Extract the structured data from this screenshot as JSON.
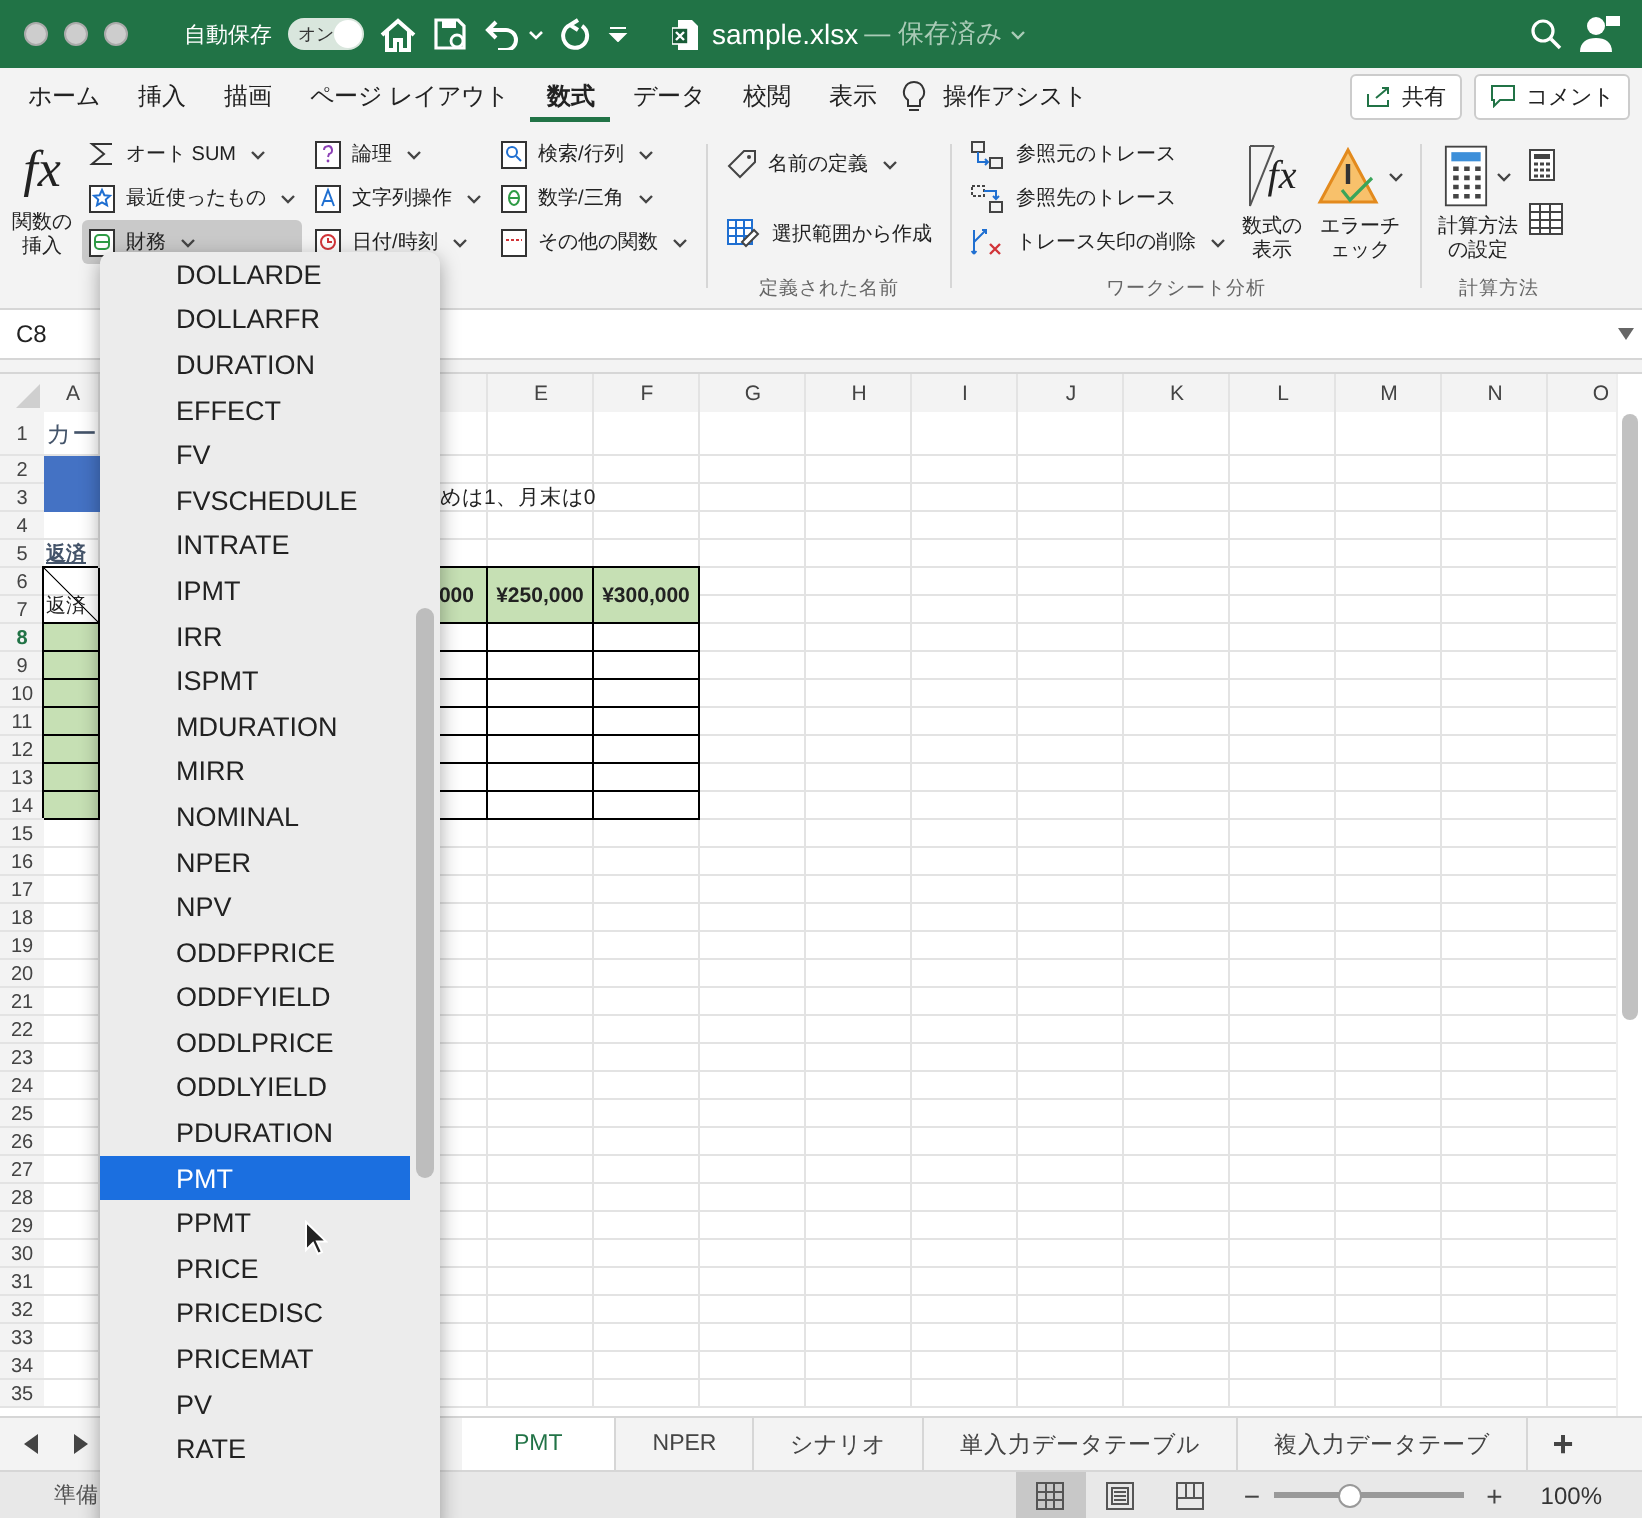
{
  "title_bar": {
    "autosave_label": "自動保存",
    "autosave_toggle": {
      "label": "オン",
      "on": true
    },
    "file_name": "sample.xlsx",
    "save_status": "— 保存済み"
  },
  "ribbon_tabs": [
    {
      "label": "ホーム",
      "selected": false
    },
    {
      "label": "挿入",
      "selected": false
    },
    {
      "label": "描画",
      "selected": false
    },
    {
      "label": "ページ レイアウト",
      "selected": false
    },
    {
      "label": "数式",
      "selected": true
    },
    {
      "label": "データ",
      "selected": false
    },
    {
      "label": "校閲",
      "selected": false
    },
    {
      "label": "表示",
      "selected": false
    }
  ],
  "assist": "操作アシスト",
  "share_button": "共有",
  "comment_button": "コメント",
  "ribbon": {
    "insert_function": {
      "icon": "fx",
      "label": "関数の挿入"
    },
    "function_columns": [
      [
        {
          "label": "オート SUM",
          "kind": "sum",
          "pressed": false
        },
        {
          "label": "最近使ったもの",
          "kind": "star",
          "pressed": false
        },
        {
          "label": "財務",
          "kind": "finance",
          "pressed": true
        }
      ],
      [
        {
          "label": "論理",
          "kind": "logic",
          "pressed": false
        },
        {
          "label": "文字列操作",
          "kind": "text",
          "pressed": false
        },
        {
          "label": "日付/時刻",
          "kind": "clock",
          "pressed": false
        }
      ],
      [
        {
          "label": "検索/行列",
          "kind": "lookup",
          "pressed": false
        },
        {
          "label": "数学/三角",
          "kind": "math",
          "pressed": false
        },
        {
          "label": "その他の関数",
          "kind": "more",
          "pressed": false
        }
      ]
    ],
    "names_group": {
      "label": "定義された名前",
      "items": [
        {
          "label": "名前の定義",
          "kind": "tag",
          "dropdown": true
        },
        {
          "label": "選択範囲から作成",
          "kind": "table",
          "dropdown": false
        }
      ]
    },
    "audit_group": {
      "label": "ワークシート分析",
      "items": [
        {
          "label": "参照元のトレース",
          "kind": "precedents",
          "dropdown": false
        },
        {
          "label": "参照先のトレース",
          "kind": "dependents",
          "dropdown": false
        },
        {
          "label": "トレース矢印の削除",
          "kind": "remove",
          "dropdown": true
        }
      ],
      "big": [
        {
          "label": "数式の表示",
          "kind": "formula",
          "icon": "fx",
          "dropdown": false
        },
        {
          "label": "エラーチェック",
          "kind": "warning",
          "dropdown": true
        }
      ]
    },
    "calc_group": {
      "label": "計算方法",
      "button": {
        "label": "計算方法の設定",
        "dropdown": true
      }
    }
  },
  "formula_bar": {
    "name_box": "C8"
  },
  "grid": {
    "columns": [
      {
        "label": "A"
      },
      {},
      {},
      {},
      {
        "label": "E"
      },
      {
        "label": "F"
      },
      {
        "label": "G"
      },
      {
        "label": "H"
      },
      {
        "label": "I"
      },
      {
        "label": "J"
      },
      {
        "label": "K"
      },
      {
        "label": "L"
      },
      {
        "label": "M"
      },
      {
        "label": "N"
      },
      {
        "label": "O"
      }
    ],
    "rows": [
      {
        "label": "1",
        "active": false,
        "cells": [
          {
            "text": "カー",
            "kind": "title"
          }
        ]
      },
      {
        "label": "2",
        "active": false,
        "cells": [
          {
            "color": "#4472c4"
          }
        ]
      },
      {
        "label": "3",
        "active": false,
        "cells": [
          {
            "color": "#4472c4"
          },
          {},
          {},
          {
            "text": "めは1、月末は0",
            "kind": "overflow"
          }
        ]
      },
      {
        "label": "4",
        "active": false
      },
      {
        "label": "5",
        "active": false,
        "cells": [
          {
            "text": "返済",
            "kind": "heading"
          }
        ]
      },
      {
        "label": "6",
        "active": false,
        "cells": [
          {
            "text": "返済",
            "kind": "diagonal",
            "merged": true
          },
          {},
          {},
          {
            "text": "000",
            "kind": "clipped",
            "merged": true,
            "color": "#c6e0b4"
          },
          {
            "text": "¥250,000",
            "kind": "money",
            "merged": true,
            "color": "#c6e0b4"
          },
          {
            "text": "¥300,000",
            "kind": "money",
            "merged": true,
            "color": "#c6e0b4"
          }
        ]
      },
      {
        "label": "7",
        "active": false
      },
      {
        "label": "8",
        "active": true,
        "cells": [
          {
            "kind": "box",
            "color": "#c6e0b4"
          },
          {},
          {},
          {
            "kind": "box"
          },
          {
            "kind": "box"
          },
          {
            "kind": "box"
          }
        ]
      },
      {
        "label": "9",
        "active": false,
        "cells": [
          {
            "kind": "box",
            "color": "#c6e0b4"
          },
          {},
          {},
          {
            "kind": "box"
          },
          {
            "kind": "box"
          },
          {
            "kind": "box"
          }
        ]
      },
      {
        "label": "10",
        "active": false,
        "cells": [
          {
            "kind": "box",
            "color": "#c6e0b4"
          },
          {},
          {},
          {
            "kind": "box"
          },
          {
            "kind": "box"
          },
          {
            "kind": "box"
          }
        ]
      },
      {
        "label": "11",
        "active": false,
        "cells": [
          {
            "kind": "box",
            "color": "#c6e0b4"
          },
          {},
          {},
          {
            "kind": "box"
          },
          {
            "kind": "box"
          },
          {
            "kind": "box"
          }
        ]
      },
      {
        "label": "12",
        "active": false,
        "cells": [
          {
            "kind": "box",
            "color": "#c6e0b4"
          },
          {},
          {},
          {
            "kind": "box"
          },
          {
            "kind": "box"
          },
          {
            "kind": "box"
          }
        ]
      },
      {
        "label": "13",
        "active": false,
        "cells": [
          {
            "kind": "box",
            "color": "#c6e0b4"
          },
          {},
          {},
          {
            "kind": "box"
          },
          {
            "kind": "box"
          },
          {
            "kind": "box"
          }
        ]
      },
      {
        "label": "14",
        "active": false,
        "cells": [
          {
            "kind": "box",
            "color": "#c6e0b4"
          },
          {},
          {},
          {
            "kind": "box"
          },
          {
            "kind": "box"
          },
          {
            "kind": "box"
          }
        ]
      },
      {
        "label": "15",
        "active": false
      },
      {
        "label": "16",
        "active": false
      },
      {
        "label": "17",
        "active": false
      },
      {
        "label": "18",
        "active": false
      },
      {
        "label": "19",
        "active": false
      },
      {
        "label": "20",
        "active": false
      },
      {
        "label": "21",
        "active": false
      },
      {
        "label": "22",
        "active": false
      },
      {
        "label": "23",
        "active": false
      },
      {
        "label": "24",
        "active": false
      },
      {
        "label": "25",
        "active": false
      },
      {
        "label": "26",
        "active": false
      },
      {
        "label": "27",
        "active": false
      },
      {
        "label": "28",
        "active": false
      },
      {
        "label": "29",
        "active": false
      },
      {
        "label": "30",
        "active": false
      },
      {
        "label": "31",
        "active": false
      },
      {
        "label": "32",
        "active": false
      },
      {
        "label": "33",
        "active": false
      },
      {
        "label": "34",
        "active": false
      },
      {
        "label": "35",
        "active": false
      }
    ]
  },
  "function_menu": {
    "items": [
      {
        "label": "DOLLARDE",
        "selected": false
      },
      {
        "label": "DOLLARFR",
        "selected": false
      },
      {
        "label": "DURATION",
        "selected": false
      },
      {
        "label": "EFFECT",
        "selected": false
      },
      {
        "label": "FV",
        "selected": false
      },
      {
        "label": "FVSCHEDULE",
        "selected": false
      },
      {
        "label": "INTRATE",
        "selected": false
      },
      {
        "label": "IPMT",
        "selected": false
      },
      {
        "label": "IRR",
        "selected": false
      },
      {
        "label": "ISPMT",
        "selected": false
      },
      {
        "label": "MDURATION",
        "selected": false
      },
      {
        "label": "MIRR",
        "selected": false
      },
      {
        "label": "NOMINAL",
        "selected": false
      },
      {
        "label": "NPER",
        "selected": false
      },
      {
        "label": "NPV",
        "selected": false
      },
      {
        "label": "ODDFPRICE",
        "selected": false
      },
      {
        "label": "ODDFYIELD",
        "selected": false
      },
      {
        "label": "ODDLPRICE",
        "selected": false
      },
      {
        "label": "ODDLYIELD",
        "selected": false
      },
      {
        "label": "PDURATION",
        "selected": false
      },
      {
        "label": "PMT",
        "selected": true
      },
      {
        "label": "PPMT",
        "selected": false
      },
      {
        "label": "PRICE",
        "selected": false
      },
      {
        "label": "PRICEDISC",
        "selected": false
      },
      {
        "label": "PRICEMAT",
        "selected": false
      },
      {
        "label": "PV",
        "selected": false
      },
      {
        "label": "RATE",
        "selected": false
      }
    ]
  },
  "sheet_tabs": [
    {
      "label": "PMT",
      "selected": true
    },
    {
      "label": "NPER",
      "selected": false
    },
    {
      "label": "シナリオ",
      "selected": false
    },
    {
      "label": "単入力データテーブル",
      "selected": false
    },
    {
      "label": "複入力データテーブ",
      "selected": false
    }
  ],
  "add_sheet": "+",
  "status_bar": {
    "text": "準備",
    "views": [
      {
        "kind": "normal",
        "selected": true
      },
      {
        "kind": "page-layout",
        "selected": false
      },
      {
        "kind": "page-break",
        "selected": false
      }
    ],
    "zoom_minus": "−",
    "zoom_plus": "+",
    "zoom": {
      "level": 0.4,
      "reading": "100%"
    }
  }
}
